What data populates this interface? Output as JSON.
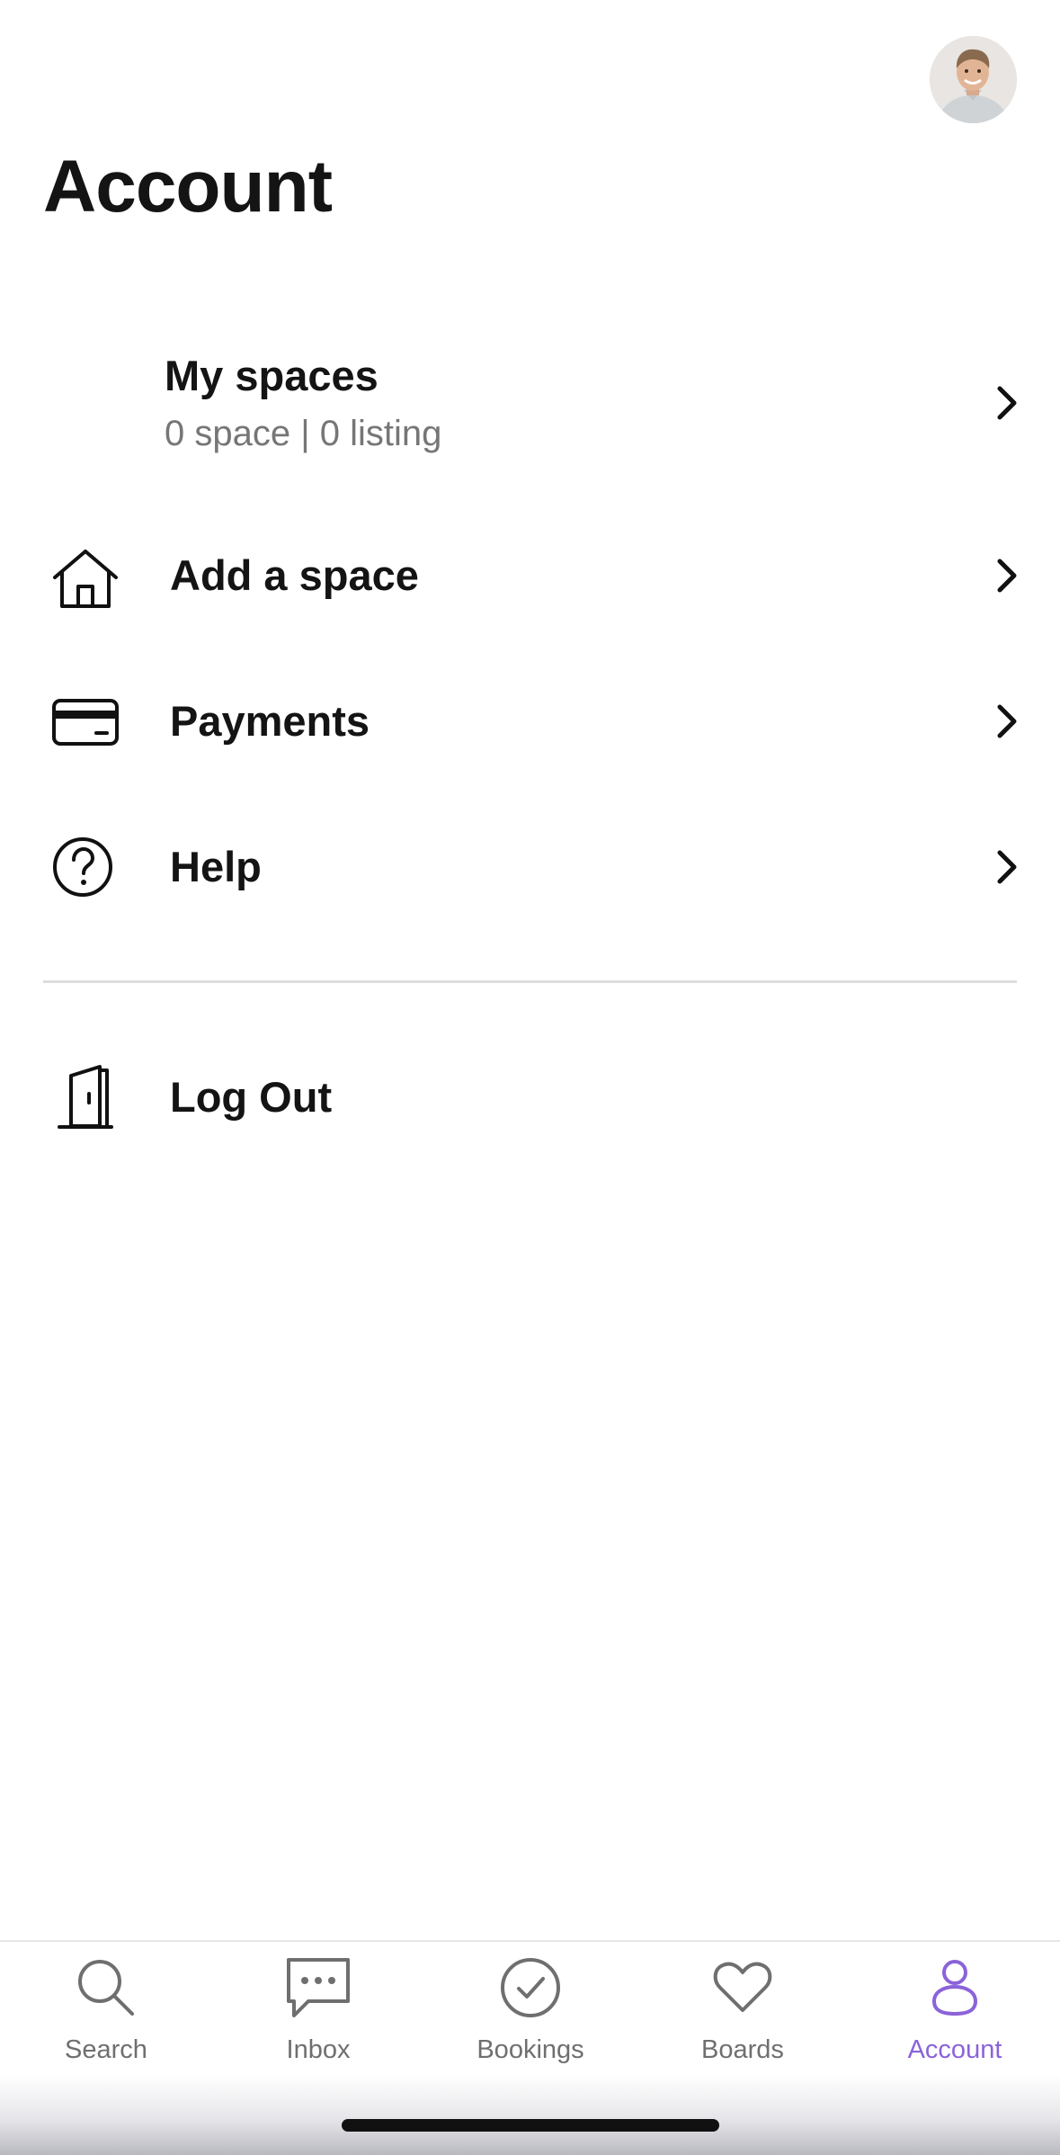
{
  "header": {
    "title": "Account",
    "avatar_icon": "user-avatar-photo"
  },
  "my_spaces": {
    "title": "My spaces",
    "subtitle": "0 space | 0 listing"
  },
  "menu": [
    {
      "label": "Add a space",
      "icon": "house-icon"
    },
    {
      "label": "Payments",
      "icon": "credit-card-icon"
    },
    {
      "label": "Help",
      "icon": "question-circle-icon"
    }
  ],
  "logout": {
    "label": "Log Out",
    "icon": "door-icon"
  },
  "tabbar": {
    "active_tab": "Account",
    "active_color": "#8b63d9",
    "items": [
      {
        "label": "Search",
        "icon": "search-icon"
      },
      {
        "label": "Inbox",
        "icon": "chat-bubble-icon"
      },
      {
        "label": "Bookings",
        "icon": "check-circle-icon"
      },
      {
        "label": "Boards",
        "icon": "heart-icon"
      },
      {
        "label": "Account",
        "icon": "person-icon"
      }
    ]
  }
}
